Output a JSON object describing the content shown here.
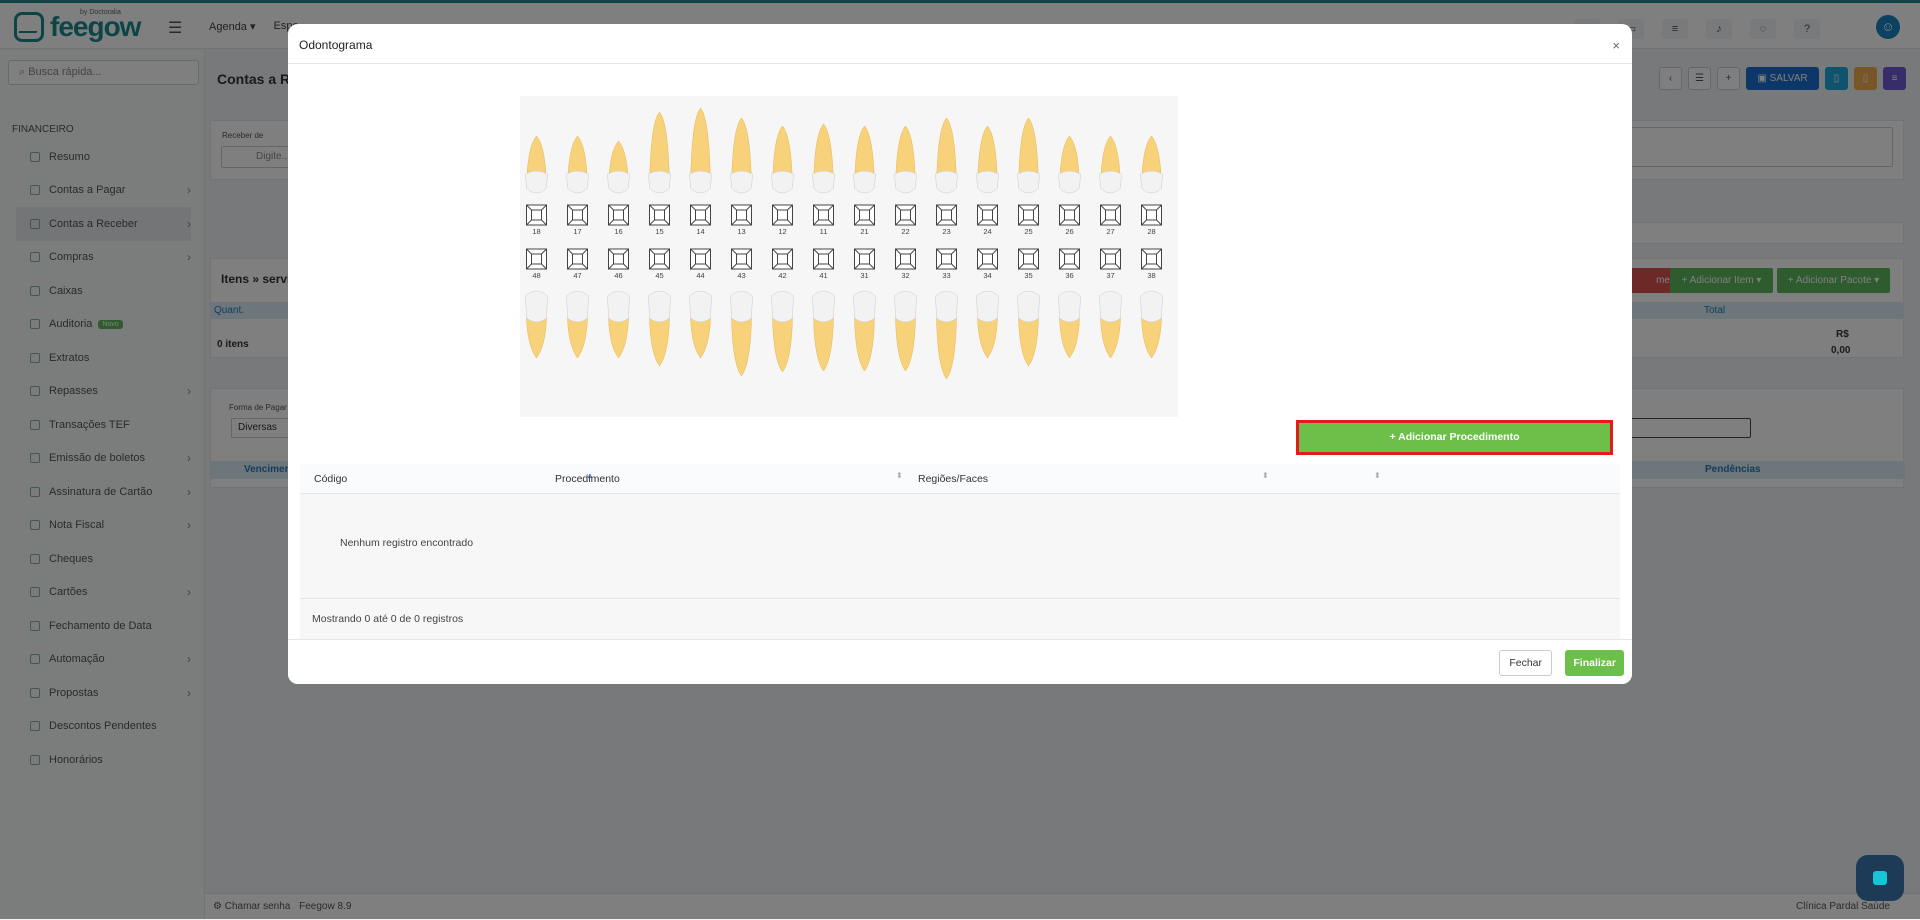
{
  "app": {
    "logo_text": "feegow",
    "logo_sub": "by Doctoralia"
  },
  "topnav": [
    "Agenda ▾",
    "Espe",
    "",
    "",
    "",
    "",
    ""
  ],
  "sidebar": {
    "search_placeholder": "Busca rápida...",
    "section_title": "FINANCEIRO",
    "items": [
      {
        "label": "Resumo",
        "chev": ""
      },
      {
        "label": "Contas a Pagar",
        "chev": "›"
      },
      {
        "label": "Contas a Receber",
        "chev": "›"
      },
      {
        "label": "Compras",
        "chev": "›"
      },
      {
        "label": "Caixas",
        "chev": ""
      },
      {
        "label": "Auditoria",
        "chev": "",
        "badge": "Novo"
      },
      {
        "label": "Extratos",
        "chev": ""
      },
      {
        "label": "Repasses",
        "chev": "›"
      },
      {
        "label": "Transações TEF",
        "chev": ""
      },
      {
        "label": "Emissão de boletos",
        "chev": "›"
      },
      {
        "label": "Assinatura de Cartão",
        "chev": "›"
      },
      {
        "label": "Nota Fiscal",
        "chev": "›"
      },
      {
        "label": "Cheques",
        "chev": ""
      },
      {
        "label": "Cartões",
        "chev": "›"
      },
      {
        "label": "Fechamento de Data",
        "chev": ""
      },
      {
        "label": "Automação",
        "chev": "›"
      },
      {
        "label": "Propostas",
        "chev": "›"
      },
      {
        "label": "Descontos Pendentes",
        "chev": ""
      },
      {
        "label": "Honorários",
        "chev": ""
      }
    ]
  },
  "page": {
    "title": "Contas a Re",
    "save_label": "SALVAR",
    "receive_from_label": "Receber de",
    "receive_from_placeholder": "Digite...",
    "items_title": "Itens » serviç",
    "qty_header": "Quant.",
    "total_header": "Total",
    "items_count": "0 itens",
    "total_currency": "R$",
    "total_value": "0,00",
    "add_item_label": "+ Adicionar Item ▾",
    "add_package_label": "+ Adicionar Pacote ▾",
    "red_btn_label": "mento",
    "payment_form_label": "Forma de Pagar",
    "payment_form_value": "Diversas",
    "due_header": "Vencimen",
    "pending_header": "Pendências",
    "footer_call": "Chamar senha",
    "footer_version": "Feegow 8.9",
    "footer_clinic": "Clínica Pardal Saúde"
  },
  "modal": {
    "title": "Odontograma",
    "close_glyph": "×",
    "upper_teeth": [
      "18",
      "17",
      "16",
      "15",
      "14",
      "13",
      "12",
      "11",
      "21",
      "22",
      "23",
      "24",
      "25",
      "26",
      "27",
      "28"
    ],
    "lower_teeth": [
      "48",
      "47",
      "46",
      "45",
      "44",
      "43",
      "42",
      "41",
      "31",
      "32",
      "33",
      "34",
      "35",
      "36",
      "37",
      "38"
    ],
    "add_procedure_label": "+ Adicionar Procedimento",
    "table": {
      "columns": [
        "Código",
        "Procedimento",
        "Regiões/Faces",
        ""
      ],
      "empty_message": "Nenhum registro encontrado",
      "info": "Mostrando 0 até 0 de 0 registros"
    },
    "close_button": "Fechar",
    "finish_button": "Finalizar"
  },
  "colors": {
    "brand": "#1a8a8f",
    "green": "#6cc04a",
    "highlight": "#e41b1b",
    "tooth_root": "#f7d27a"
  }
}
